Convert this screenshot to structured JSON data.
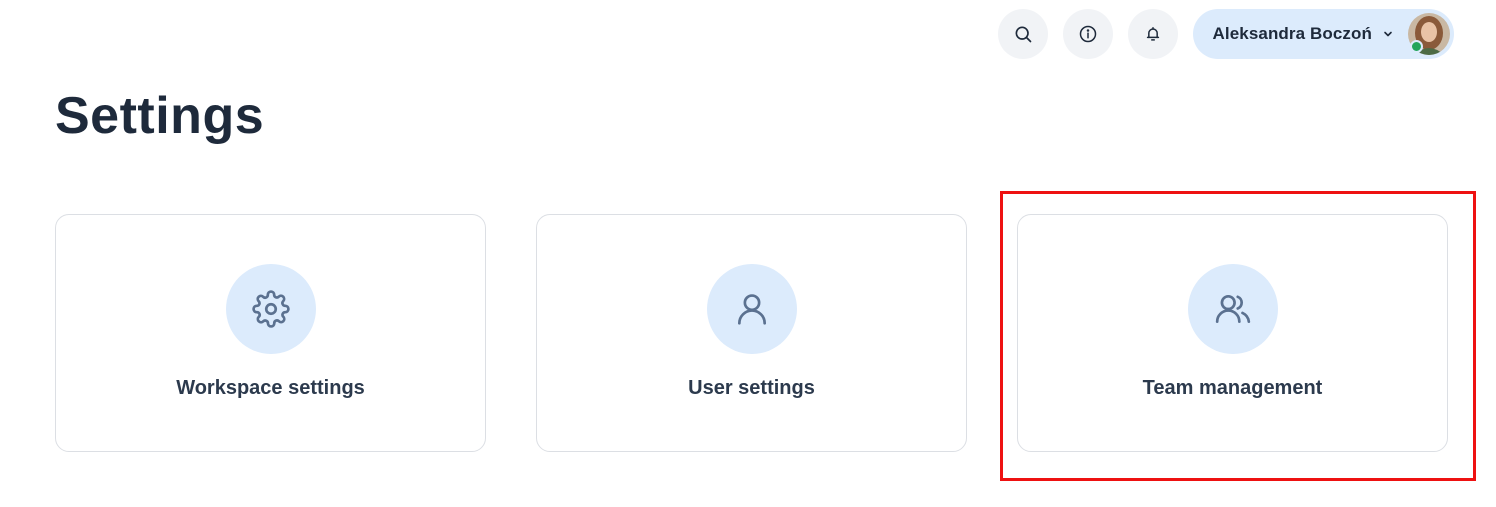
{
  "header": {
    "icons": {
      "search": "search-icon",
      "info": "info-icon",
      "notifications": "bell-icon"
    },
    "user": {
      "name": "Aleksandra Boczoń",
      "status_color": "#22a55b"
    }
  },
  "page": {
    "title": "Settings"
  },
  "cards": [
    {
      "label": "Workspace settings",
      "icon": "gear-icon"
    },
    {
      "label": "User settings",
      "icon": "user-icon"
    },
    {
      "label": "Team management",
      "icon": "users-icon"
    }
  ],
  "colors": {
    "accent_bg": "#dcebfc",
    "icon_stroke": "#5b7190",
    "highlight": "#ee1111"
  }
}
